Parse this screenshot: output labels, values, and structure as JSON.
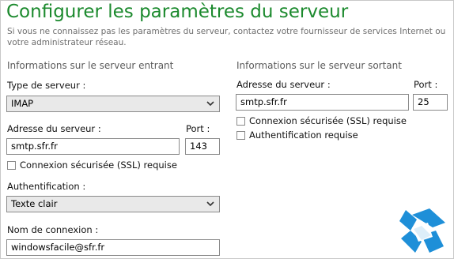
{
  "header": {
    "title": "Configurer les paramètres du serveur",
    "subtitle": "Si vous ne connaissez pas les paramètres du serveur, contactez votre fournisseur de services Internet ou votre administrateur réseau."
  },
  "incoming": {
    "section_title": "Informations sur le serveur entrant",
    "server_type_label": "Type de serveur :",
    "server_type_value": "IMAP",
    "address_label": "Adresse du serveur :",
    "address_value": "smtp.sfr.fr",
    "port_label": "Port :",
    "port_value": "143",
    "ssl_label": "Connexion sécurisée (SSL) requise",
    "ssl_checked": false,
    "auth_label": "Authentification :",
    "auth_value": "Texte clair",
    "login_label": "Nom de connexion :",
    "login_value": "windowsfacile@sfr.fr"
  },
  "outgoing": {
    "section_title": "Informations sur le serveur sortant",
    "address_label": "Adresse du serveur :",
    "address_value": "smtp.sfr.fr",
    "port_label": "Port :",
    "port_value": "25",
    "ssl_label": "Connexion sécurisée (SSL) requise",
    "ssl_checked": false,
    "auth_required_label": "Authentification requise",
    "auth_required_checked": false
  },
  "colors": {
    "title": "#1c8a2e",
    "logo_blue": "#1e8fd8"
  },
  "icons": {
    "dropdown": "chevron-down-icon",
    "logo": "windowsfacile-logo-icon"
  }
}
